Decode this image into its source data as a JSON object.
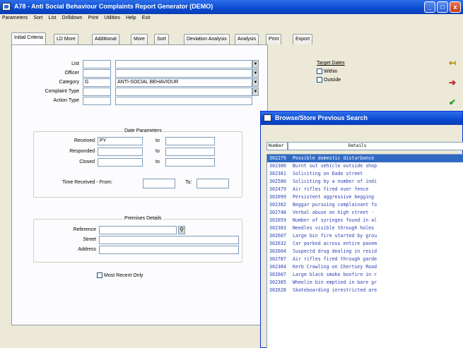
{
  "window": {
    "title": "A78 - Anti Social Behaviour Complaints Report Generator (DEMO)",
    "minimize": "_",
    "maximize": "□",
    "close": "x"
  },
  "menu": [
    "Parameters",
    "Sort",
    "List",
    "Drilldown",
    "Print",
    "Utilities",
    "Help",
    "Exit"
  ],
  "tabs": [
    "Initial Criteria",
    "LD More",
    "Additional",
    "More",
    "Sort",
    "Deviation Analysis",
    "Analysis",
    "Print",
    "Export"
  ],
  "form": {
    "labels": {
      "list": "List",
      "officer": "Officer",
      "category": "Category",
      "complaint_type": "Complaint Type",
      "action_type": "Action Type"
    },
    "values": {
      "list": "",
      "officer": "",
      "category_code": "G",
      "category_desc": "ANTI-SOCIAL BEHAVIOUR",
      "complaint_type": "",
      "action_type": ""
    },
    "target_dates": {
      "title": "Target Dates",
      "within": "Within",
      "outside": "Outside"
    },
    "date_params": {
      "title": "Date Parameters",
      "received": "Received",
      "received_value": "PY",
      "responded": "Responded",
      "closed": "Closed",
      "to": "to",
      "time_received_from": "Time Received - From:",
      "time_to": "To:"
    },
    "premises": {
      "title": "Premises Details",
      "reference": "Reference",
      "street": "Street",
      "address": "Address"
    },
    "most_recent_only": "Most Recent Only"
  },
  "popup": {
    "title": "Browse/Store Previous Search",
    "col_number": "Number",
    "col_details": "Details",
    "rows": [
      {
        "id": "302279",
        "text": "Possible domestic disturbance"
      },
      {
        "id": "302380",
        "text": "Burnt out vehicle outside shop"
      },
      {
        "id": "302381",
        "text": "Soliciting on Dade street"
      },
      {
        "id": "302580",
        "text": "Soliciting by a number of indi"
      },
      {
        "id": "302479",
        "text": "Air rifles fired over fence"
      },
      {
        "id": "302099",
        "text": "Persistent aggressive begging"
      },
      {
        "id": "302382",
        "text": "Beggar pursuing complainant fo"
      },
      {
        "id": "302748",
        "text": "Verbal abuse on high street -"
      },
      {
        "id": "302059",
        "text": "Number of syringes found in al"
      },
      {
        "id": "302383",
        "text": "Needles visible through holes"
      },
      {
        "id": "302607",
        "text": "Large bin fire started by grou"
      },
      {
        "id": "302632",
        "text": "Car parked across entire pavem"
      },
      {
        "id": "302604",
        "text": "Suspectd drug dealing in resid"
      },
      {
        "id": "302787",
        "text": "Air rifles fired through garde"
      },
      {
        "id": "302384",
        "text": "Kerb Crawling on Chertsey Road"
      },
      {
        "id": "302607",
        "text": "Large black smoke bonfire in r"
      },
      {
        "id": "302385",
        "text": "Wheelie bin emptied in bare gr"
      },
      {
        "id": "302628",
        "text": "Skateboarding inrestricted are"
      }
    ]
  },
  "colors": {
    "titlebar": "#0a4ad0",
    "selection": "#316ac5",
    "list_text": "#2b3fb0"
  }
}
